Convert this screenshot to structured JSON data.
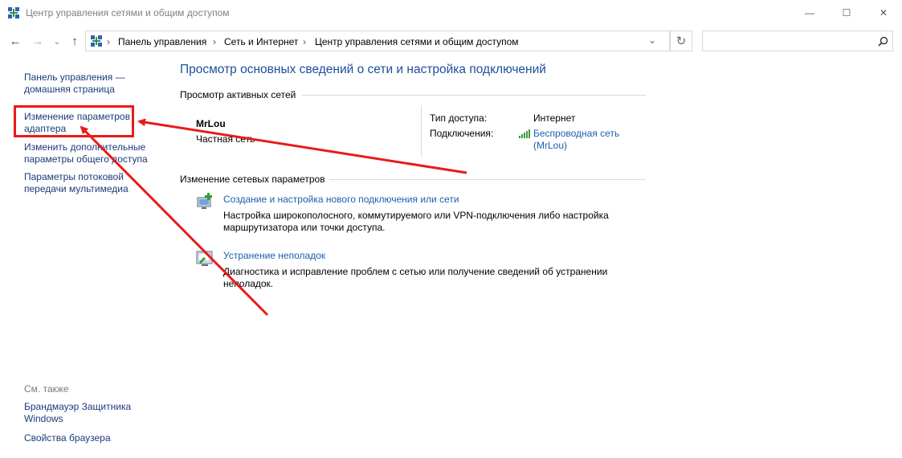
{
  "window": {
    "title": "Центр управления сетями и общим доступом",
    "controls": {
      "minimize": "—",
      "maximize": "☐",
      "close": "✕"
    }
  },
  "address_bar": {
    "breadcrumbs": [
      "Панель управления",
      "Сеть и Интернет",
      "Центр управления сетями и общим доступом"
    ],
    "separator": "›",
    "dropdown": "⌄",
    "refresh": "↻",
    "search_placeholder": ""
  },
  "nav": {
    "back": "←",
    "forward": "→",
    "recent": "⌄",
    "up": "↑"
  },
  "sidebar": {
    "links": [
      "Панель управления — домашняя страница",
      "Изменение параметров адаптера",
      "Изменить дополнительные параметры общего доступа",
      "Параметры потоковой передачи мультимедиа"
    ],
    "see_also_title": "См. также",
    "see_also": [
      "Брандмауэр Защитника Windows",
      "Свойства браузера"
    ]
  },
  "main": {
    "heading": "Просмотр основных сведений о сети и настройка подключений",
    "active_networks_title": "Просмотр активных сетей",
    "network": {
      "name": "MrLou",
      "type": "Частная сеть",
      "access_label": "Тип доступа:",
      "access_value": "Интернет",
      "connections_label": "Подключения:",
      "connection_value": "Беспроводная сеть (MrLou)"
    },
    "change_settings_title": "Изменение сетевых параметров",
    "tasks": [
      {
        "title": "Создание и настройка нового подключения или сети",
        "description": "Настройка широкополосного, коммутируемого или VPN-подключения либо настройка маршрутизатора или точки доступа."
      },
      {
        "title": "Устранение неполадок",
        "description": "Диагностика и исправление проблем с сетью или получение сведений об устранении неполадок."
      }
    ]
  },
  "colors": {
    "annotation": "#e81b1b",
    "link": "#1c5fb0",
    "heading": "#1e4e9c"
  }
}
